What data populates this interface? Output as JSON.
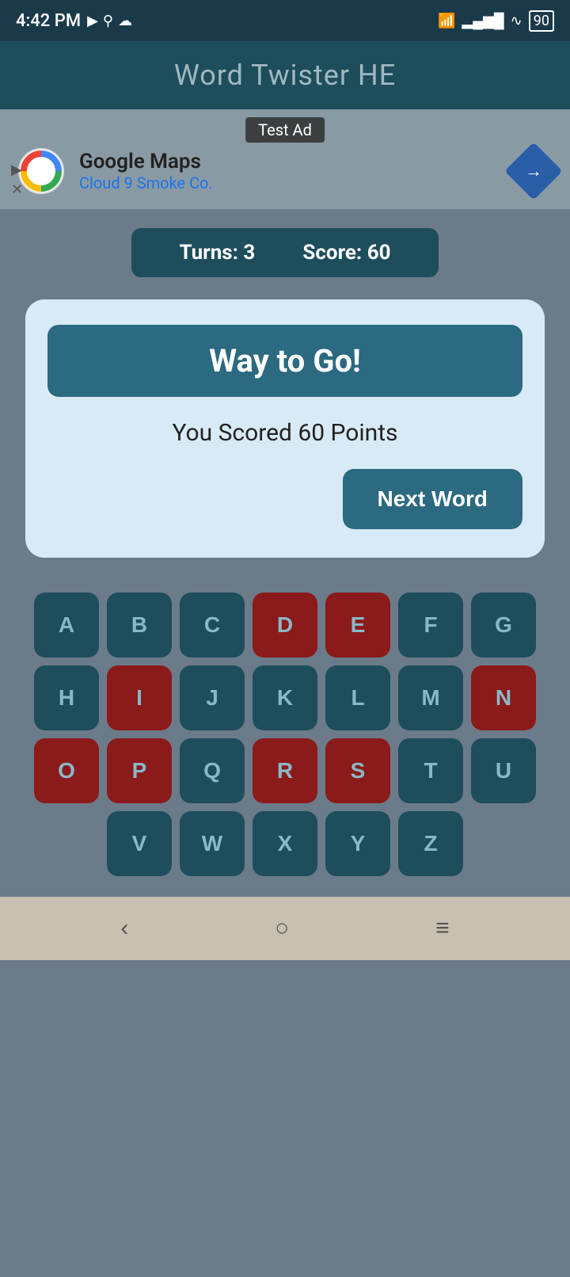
{
  "statusBar": {
    "time": "4:42 PM",
    "battery": "90"
  },
  "header": {
    "title": "Word Twister HE"
  },
  "ad": {
    "testLabel": "Test Ad",
    "name": "Google Maps",
    "sub": "Cloud 9 Smoke Co."
  },
  "scoreBar": {
    "turnsLabel": "Turns:",
    "turnsValue": "3",
    "scoreLabel": "Score:",
    "scoreValue": "60"
  },
  "dialog": {
    "title": "Way to Go!",
    "scoreText": "You Scored 60 Points",
    "nextWordBtn": "Next Word"
  },
  "keyboard": {
    "rows": [
      [
        {
          "letter": "A",
          "used": false
        },
        {
          "letter": "B",
          "used": false
        },
        {
          "letter": "C",
          "used": false
        },
        {
          "letter": "D",
          "used": true
        },
        {
          "letter": "E",
          "used": true
        },
        {
          "letter": "F",
          "used": false
        },
        {
          "letter": "G",
          "used": false
        }
      ],
      [
        {
          "letter": "H",
          "used": false
        },
        {
          "letter": "I",
          "used": true
        },
        {
          "letter": "J",
          "used": false
        },
        {
          "letter": "K",
          "used": false
        },
        {
          "letter": "L",
          "used": false
        },
        {
          "letter": "M",
          "used": false
        },
        {
          "letter": "N",
          "used": true
        }
      ],
      [
        {
          "letter": "O",
          "used": true
        },
        {
          "letter": "P",
          "used": true
        },
        {
          "letter": "Q",
          "used": false
        },
        {
          "letter": "R",
          "used": true
        },
        {
          "letter": "S",
          "used": true
        },
        {
          "letter": "T",
          "used": false
        },
        {
          "letter": "U",
          "used": false
        }
      ],
      [
        {
          "letter": "V",
          "used": false
        },
        {
          "letter": "W",
          "used": false
        },
        {
          "letter": "X",
          "used": false
        },
        {
          "letter": "Y",
          "used": false
        },
        {
          "letter": "Z",
          "used": false
        }
      ]
    ]
  },
  "navBar": {
    "backLabel": "‹",
    "homeLabel": "○",
    "menuLabel": "≡"
  }
}
